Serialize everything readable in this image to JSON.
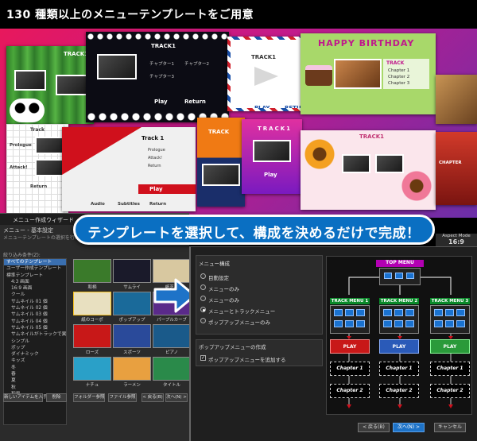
{
  "header": {
    "title": "130 種類以上のメニューテンプレートをご用意"
  },
  "collage": {
    "tile1": {
      "label": "TRACK1"
    },
    "tile2": {
      "label": "TRACK1",
      "items": [
        "チャプター1",
        "チャプター2",
        "チャプター3"
      ],
      "play": "Play",
      "return": "Return"
    },
    "tile3": {
      "label": "TRACK1",
      "play": "PLAY",
      "return": "RETUR"
    },
    "tile4": {
      "banner": "HAPPY BIRTHDAY",
      "label": "TRACK",
      "items": [
        "Chapter 1",
        "Chapter 2",
        "Chapter 3"
      ]
    },
    "tile5": {
      "label": "Track",
      "items": [
        "Prologue",
        "Attack!",
        "Return"
      ]
    },
    "tile6": {
      "label": "Track 1",
      "items": [
        "Prologue",
        "Attack!",
        "Return"
      ],
      "play": "Play",
      "bottom": [
        "Audio",
        "Subtitles",
        "Return"
      ]
    },
    "tile7": {
      "label": "TRACK",
      "play": "Play"
    },
    "tile8": {
      "label": "TRACK1"
    },
    "tile9": {
      "label": "CHAPTER"
    }
  },
  "wizard": {
    "title": "メニュー作成ウィザード",
    "subtitle": "メニュー - 基本設定",
    "desc": "メニューテンプレートの選択を行います。",
    "filter": "絞り込み条件(Z):",
    "tree": [
      "すべてのテンプレート",
      "ユーザー作成テンプレート",
      "標準テンプレート",
      "4:3 画面",
      "16:9 画面",
      "クール",
      "サムネイル 01 個",
      "サムネイル 02 個",
      "サムネイル 03 個",
      "サムネイル 04 個",
      "サムネイル 05 個",
      "サムネイルがトラックで異なる",
      "シンプル",
      "ポップ",
      "ダイナミック",
      "キッズ",
      "冬",
      "春",
      "夏",
      "秋",
      "和風",
      "その他"
    ],
    "cells": [
      "和柄",
      "サムライ",
      "紙芝居",
      "紙のコーポ",
      "ポップアップ",
      "パープルカーブ",
      "ローズ",
      "スポーツ",
      "ピアノ",
      "ナチュ",
      "ラーメン",
      "タイトル"
    ],
    "buttons": [
      "新しいアイテムを入手",
      "削除",
      "フォルダー参照",
      "ファイル参照",
      "< 戻る(B)",
      "次へ(N) >"
    ]
  },
  "banner": {
    "text": "テンプレートを選択して、構成を決めるだけで完成！"
  },
  "panel": {
    "aspect_label": "Aspect Mode",
    "aspect_value": "16:9",
    "section_title": "メニュー構成",
    "options": [
      "目動設定",
      "メニューのみ",
      "メニューのみ",
      "メニューとトラックメニュー",
      "ポップアップメニューのみ"
    ],
    "popup_section": "ポップアップメニューの作成",
    "popup_check": "ポップアップメニューを追加する",
    "buttons": {
      "back": "< 戻る(B)",
      "next": "次へ(N) >",
      "cancel": "キャンセル"
    }
  },
  "diagram": {
    "top": "TOP MENU",
    "tracks": [
      "TRACK MENU 1",
      "TRACK MENU 2",
      "TRACK MENU 3"
    ],
    "play": "PLAY",
    "chapter1": "Chapter 1",
    "chapter2": "Chapter 2"
  },
  "colors": {
    "accent": "#1e73c8",
    "banner": "#0a6fc2",
    "track": "#0a8a2a",
    "top": "#b300b3"
  }
}
